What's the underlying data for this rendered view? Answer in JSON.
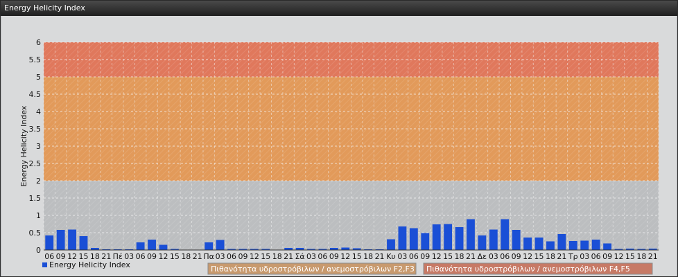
{
  "window": {
    "title": "Energy Helicity Index"
  },
  "chart_data": {
    "type": "bar",
    "title": "",
    "xlabel": "",
    "ylabel": "Energy Helicity Index",
    "ylim": [
      0,
      6
    ],
    "yticks": [
      "0",
      "0.5",
      "1",
      "1.5",
      "2",
      "2.5",
      "3",
      "3.5",
      "4",
      "4.5",
      "5",
      "5.5",
      "6"
    ],
    "grid": true,
    "legend_position": "bottom-left",
    "series": [
      {
        "name": "Energy Helicity Index",
        "color": "#1a4fd6",
        "categories": [
          "06",
          "09",
          "12",
          "15",
          "18",
          "21",
          "Πέ",
          "03",
          "06",
          "09",
          "12",
          "15",
          "18",
          "21",
          "Πα",
          "03",
          "06",
          "09",
          "12",
          "15",
          "18",
          "21",
          "Σά",
          "03",
          "06",
          "09",
          "12",
          "15",
          "18",
          "21",
          "Κυ",
          "03",
          "06",
          "09",
          "12",
          "15",
          "18",
          "21",
          "Δε",
          "03",
          "06",
          "09",
          "12",
          "15",
          "18",
          "21",
          "Τρ",
          "03",
          "06",
          "09",
          "12",
          "15",
          "18",
          "21"
        ],
        "values": [
          0.42,
          0.58,
          0.59,
          0.4,
          0.06,
          0.02,
          0.02,
          0.02,
          0.22,
          0.3,
          0.15,
          0.03,
          0.0,
          0.0,
          0.22,
          0.29,
          0.03,
          0.03,
          0.03,
          0.03,
          0.0,
          0.06,
          0.06,
          0.03,
          0.03,
          0.06,
          0.07,
          0.05,
          0.02,
          0.02,
          0.31,
          0.68,
          0.63,
          0.49,
          0.74,
          0.75,
          0.66,
          0.89,
          0.42,
          0.59,
          0.89,
          0.58,
          0.36,
          0.36,
          0.25,
          0.46,
          0.26,
          0.27,
          0.3,
          0.19,
          0.03,
          0.04,
          0.03,
          0.04
        ]
      }
    ],
    "bands": [
      {
        "name": "Πιθανότητα υδροστρόβιλων / ανεμοστρόβιλων F2,F3",
        "range": [
          2,
          5
        ],
        "color": "#e29a5a"
      },
      {
        "name": "Πιθανότητα υδροστρόβιλων / ανεμοστρόβιλων F4,F5",
        "range": [
          5,
          6
        ],
        "color": "#e0785c"
      }
    ]
  }
}
